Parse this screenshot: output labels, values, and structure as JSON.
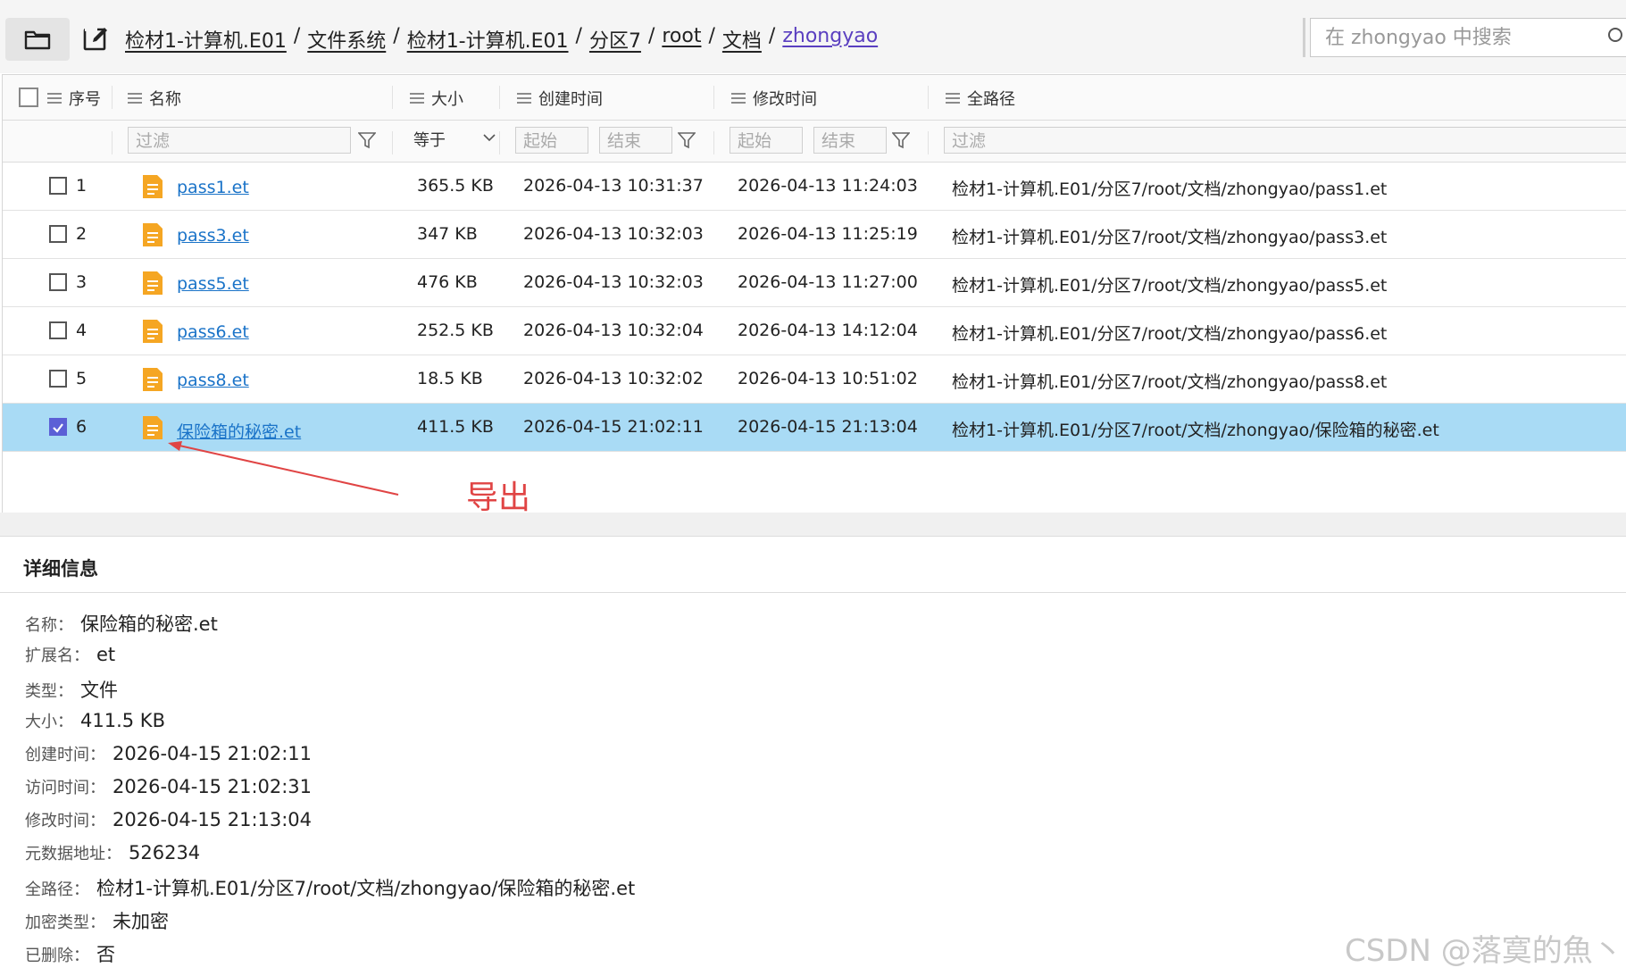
{
  "toolbar": {
    "folder_icon": "folder-icon",
    "edit_icon": "edit-icon"
  },
  "breadcrumb": [
    {
      "label": "检材1-计算机.E01"
    },
    {
      "label": "文件系统"
    },
    {
      "label": "检材1-计算机.E01"
    },
    {
      "label": "分区7"
    },
    {
      "label": "root"
    },
    {
      "label": "文档"
    },
    {
      "label": "zhongyao"
    }
  ],
  "breadcrumb_separator": "/",
  "search": {
    "placeholder": "在 zhongyao 中搜索"
  },
  "columns": {
    "index": "序号",
    "name": "名称",
    "size": "大小",
    "created": "创建时间",
    "modified": "修改时间",
    "path": "全路径"
  },
  "filters": {
    "name": "过滤",
    "size_op": "等于",
    "created_start": "起始",
    "created_end": "结束",
    "modified_start": "起始",
    "modified_end": "结束",
    "path": "过滤"
  },
  "rows": [
    {
      "index": "1",
      "name": "pass1.et",
      "size": "365.5 KB",
      "created": "2026-04-13 10:31:37",
      "modified": "2026-04-13 11:24:03",
      "path": "检材1-计算机.E01/分区7/root/文档/zhongyao/pass1.et",
      "checked": false
    },
    {
      "index": "2",
      "name": "pass3.et",
      "size": "347 KB",
      "created": "2026-04-13 10:32:03",
      "modified": "2026-04-13 11:25:19",
      "path": "检材1-计算机.E01/分区7/root/文档/zhongyao/pass3.et",
      "checked": false
    },
    {
      "index": "3",
      "name": "pass5.et",
      "size": "476 KB",
      "created": "2026-04-13 10:32:03",
      "modified": "2026-04-13 11:27:00",
      "path": "检材1-计算机.E01/分区7/root/文档/zhongyao/pass5.et",
      "checked": false
    },
    {
      "index": "4",
      "name": "pass6.et",
      "size": "252.5 KB",
      "created": "2026-04-13 10:32:04",
      "modified": "2026-04-13 14:12:04",
      "path": "检材1-计算机.E01/分区7/root/文档/zhongyao/pass6.et",
      "checked": false
    },
    {
      "index": "5",
      "name": "pass8.et",
      "size": "18.5 KB",
      "created": "2026-04-13 10:32:02",
      "modified": "2026-04-13 10:51:02",
      "path": "检材1-计算机.E01/分区7/root/文档/zhongyao/pass8.et",
      "checked": false
    },
    {
      "index": "6",
      "name": "保险箱的秘密.et",
      "size": "411.5 KB",
      "created": "2026-04-15 21:02:11",
      "modified": "2026-04-15 21:13:04",
      "path": "检材1-计算机.E01/分区7/root/文档/zhongyao/保险箱的秘密.et",
      "checked": true
    }
  ],
  "annotation": {
    "label": "导出",
    "color": "#e04444"
  },
  "detail": {
    "title": "详细信息",
    "fields": [
      {
        "label": "名称：",
        "value": "保险箱的秘密.et"
      },
      {
        "label": "扩展名：",
        "value": "et"
      },
      {
        "label": "类型：",
        "value": "文件"
      },
      {
        "label": "大小：",
        "value": "411.5 KB"
      },
      {
        "label": "创建时间：",
        "value": "2026-04-15 21:02:11"
      },
      {
        "label": "访问时间：",
        "value": "2026-04-15 21:02:31"
      },
      {
        "label": "修改时间：",
        "value": "2026-04-15 21:13:04"
      },
      {
        "label": "元数据地址：",
        "value": "526234"
      },
      {
        "label": "全路径：",
        "value": "检材1-计算机.E01/分区7/root/文档/zhongyao/保险箱的秘密.et"
      },
      {
        "label": "加密类型：",
        "value": "未加密"
      },
      {
        "label": "已删除：",
        "value": "否"
      }
    ]
  },
  "watermark": "CSDN @落寞的魚丶",
  "colors": {
    "selected_row": "#a9dbf5",
    "link": "#1a73c8",
    "checkbox_checked": "#5b5fd6",
    "file_icon": "#f5a623"
  }
}
